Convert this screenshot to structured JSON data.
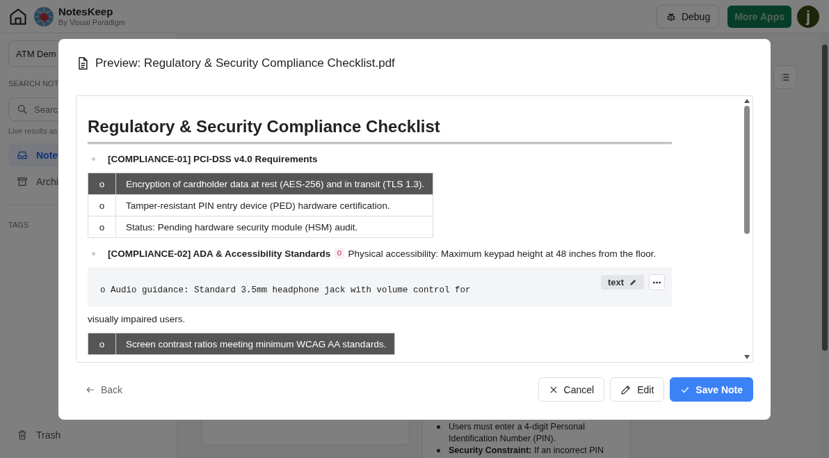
{
  "header": {
    "app_name": "NotesKeep",
    "app_subtitle": "By Visual Paradigm",
    "debug_button": "Debug",
    "more_apps_button": "More Apps",
    "avatar_initial": "j"
  },
  "sidebar": {
    "notebook": "ATM Dem",
    "search_label": "SEARCH NOT",
    "search_placeholder": "Searc",
    "search_hint": "Live results as",
    "items": [
      {
        "label": "Note",
        "selected": true
      },
      {
        "label": "Archi",
        "selected": false
      }
    ],
    "tags_label": "TAGS",
    "trash": "Trash"
  },
  "note_panel": {
    "items": [
      "Users must enter a 4-digit Personal Identification Number (PIN).",
      "**Security Constraint:** If an incorrect PIN"
    ]
  },
  "dialog": {
    "title": "Preview: Regulatory & Security Compliance Checklist.pdf",
    "blocks": [
      {
        "kind": "heading",
        "text": "Regulatory & Security Compliance Checklist"
      },
      {
        "kind": "bullet",
        "title": "[COMPLIANCE-01] PCI-DSS v4.0 Requirements"
      },
      {
        "kind": "table",
        "rows": [
          {
            "kind": "head",
            "cells": [
              "o",
              "Encryption of cardholder data at rest (AES-256) and in transit (TLS 1.3)."
            ]
          },
          {
            "kind": "body",
            "cells": [
              "o",
              "Tamper-resistant PIN entry device (PED) hardware certification."
            ]
          },
          {
            "kind": "body",
            "cells": [
              "o",
              "Status: Pending hardware security module (HSM) audit."
            ]
          }
        ]
      },
      {
        "kind": "bullet",
        "title": "[COMPLIANCE-02] ADA & Accessibility Standards",
        "inline_code": "o",
        "text": "Physical accessibility: Maximum keypad height at 48 inches from the floor."
      },
      {
        "kind": "code",
        "code": "o Audio guidance: Standard 3.5mm headphone jack with volume control for",
        "language": "text"
      },
      {
        "kind": "paragraph",
        "text": "visually impaired users."
      },
      {
        "kind": "table",
        "rows": [
          {
            "kind": "head",
            "cells": [
              "o",
              "Screen contrast ratios meeting minimum WCAG AA standards."
            ]
          }
        ]
      }
    ],
    "back": "Back",
    "cancel": "Cancel",
    "edit": "Edit",
    "save": "Save Note"
  }
}
